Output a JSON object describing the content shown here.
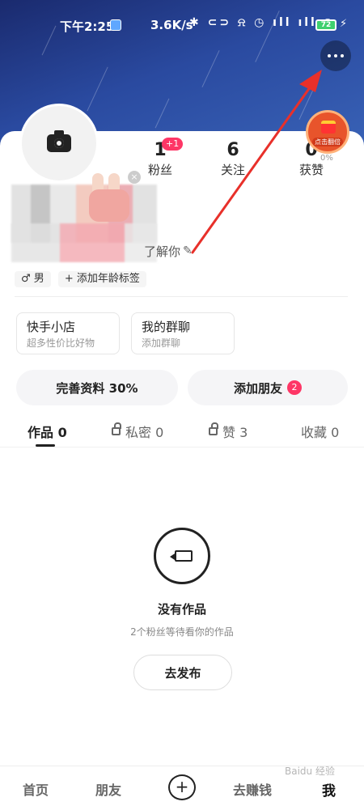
{
  "status_bar": {
    "time": "下午2:25",
    "speed": "3.6K/s",
    "icons": "✱ ⊂⊃ ⍾ ◷ ıll ıll ◠",
    "battery": "72"
  },
  "header": {
    "more_button": "more-icon"
  },
  "profile": {
    "bio_fragment": "了解你",
    "tags": [
      "♂ 男",
      "+ 添加年龄标签"
    ]
  },
  "stats": [
    {
      "value": "1",
      "label": "粉丝",
      "badge": "+1"
    },
    {
      "value": "6",
      "label": "关注"
    },
    {
      "value": "0",
      "label": "获赞"
    }
  ],
  "redpacket": {
    "label": "点击翻倍",
    "pct": "0%"
  },
  "quick_cards": [
    {
      "title": "快手小店",
      "subtitle": "超多性价比好物"
    },
    {
      "title": "我的群聊",
      "subtitle": "添加群聊"
    }
  ],
  "actions": {
    "complete_profile": "完善资料 30%",
    "add_friends": "添加朋友",
    "add_friends_badge": "2"
  },
  "tabs": [
    {
      "label": "作品 0"
    },
    {
      "label": "私密 0"
    },
    {
      "label": "赞 3"
    },
    {
      "label": "收藏 0"
    }
  ],
  "empty_state": {
    "title": "没有作品",
    "subtitle": "2个粉丝等待看你的作品",
    "button": "去发布"
  },
  "bottom_nav": {
    "home": "首页",
    "friends": "朋友",
    "plus": "+",
    "earn": "去赚钱",
    "me": "我"
  },
  "watermark": "Baidu 经验",
  "colors": {
    "accent": "#fe3666",
    "annotation_arrow": "#e8302a",
    "header_top": "#1a2a6e",
    "header_bottom": "#3a64b8"
  }
}
